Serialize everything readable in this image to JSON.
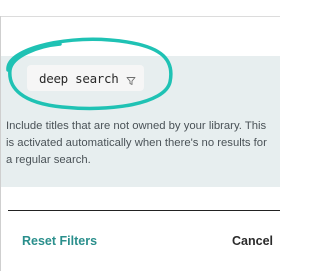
{
  "filter": {
    "chip_label": "deep search",
    "chip_icon": "filter-funnel-icon",
    "hint": "Include titles that are not owned by your library. This is activated automatically when there's no results for a regular search."
  },
  "footer": {
    "reset_label": "Reset Filters",
    "cancel_label": "Cancel"
  },
  "colors": {
    "accent": "#2a8f8c",
    "annotation": "#1fc2b4",
    "section_bg": "#e7eeef",
    "chip_bg": "#f6f6f6"
  }
}
